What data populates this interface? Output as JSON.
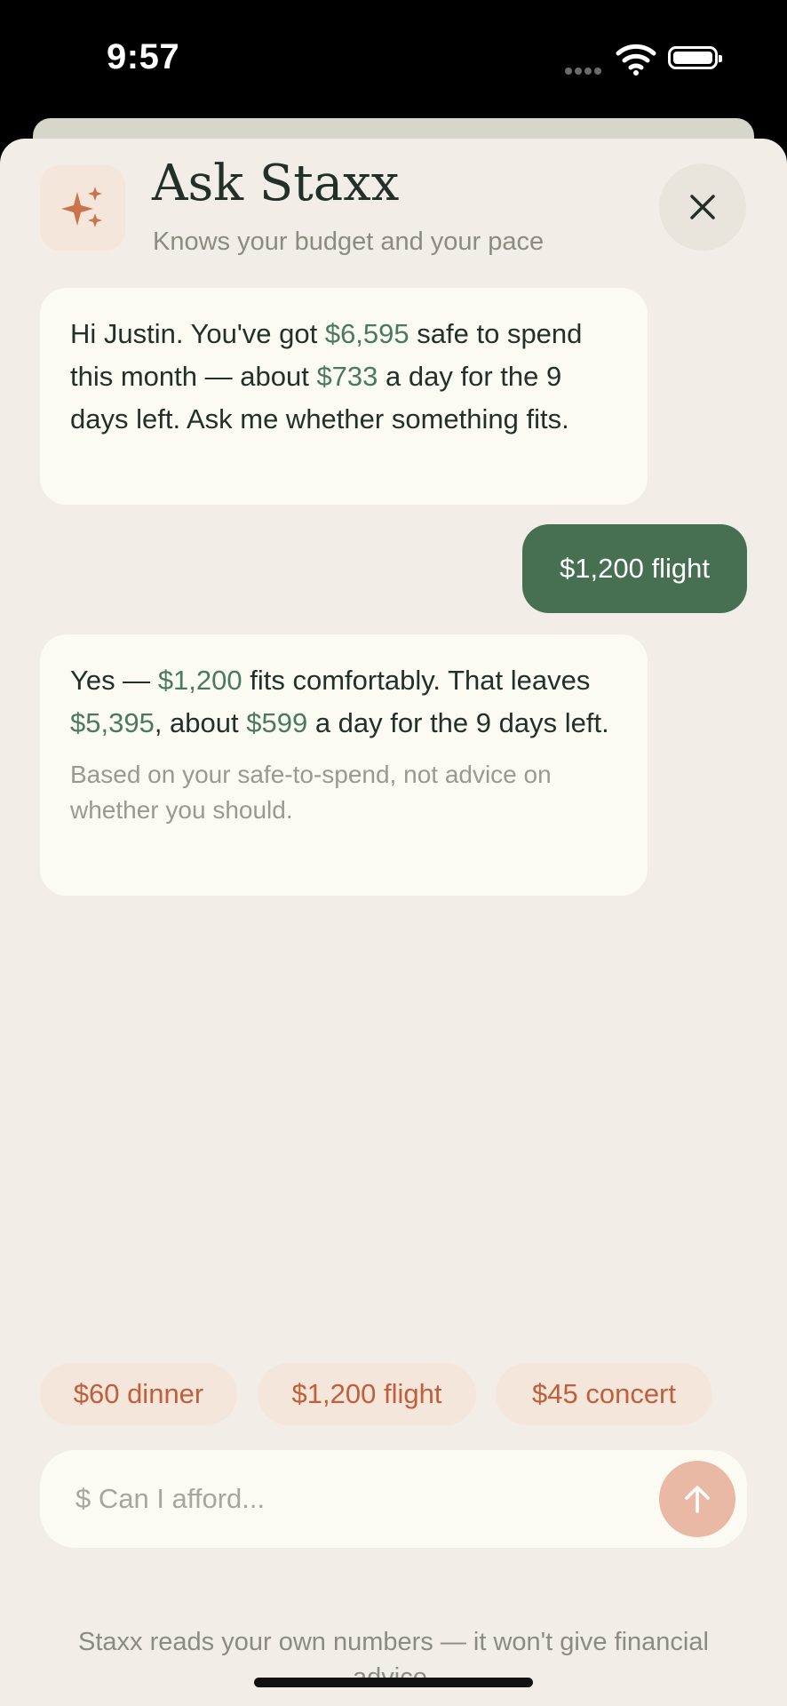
{
  "status": {
    "time": "9:57"
  },
  "header": {
    "title": "Ask Staxx",
    "subtitle": "Knows your budget and your pace",
    "icon": "sparkle-icon",
    "close_icon": "close-icon"
  },
  "messages": {
    "ai_greeting": {
      "t1": "Hi Justin. You've got ",
      "m1": "$6,595",
      "t2": " safe to spend this month — about ",
      "m2": "$733",
      "t3": " a day for the 9 days left. Ask me whether something fits."
    },
    "user_1": "$1,200 flight",
    "ai_reply": {
      "t1": "Yes — ",
      "m1": "$1,200",
      "t2": " fits comfortably. That leaves ",
      "m2": "$5,395",
      "t3": ", about ",
      "m3": "$599",
      "t4": " a day for the 9 days left.",
      "note": "Based on your safe-to-spend, not advice on whether you should."
    }
  },
  "suggestions": [
    "$60 dinner",
    "$1,200 flight",
    "$45 concert"
  ],
  "input": {
    "placeholder": "$ Can I afford...",
    "value": ""
  },
  "footer": "Staxx reads your own numbers — it won't give financial advice.",
  "colors": {
    "accent_green": "#477052",
    "money_green": "#4a7a5e",
    "accent_orange": "#c05f3a",
    "background": "#f2eee7"
  }
}
